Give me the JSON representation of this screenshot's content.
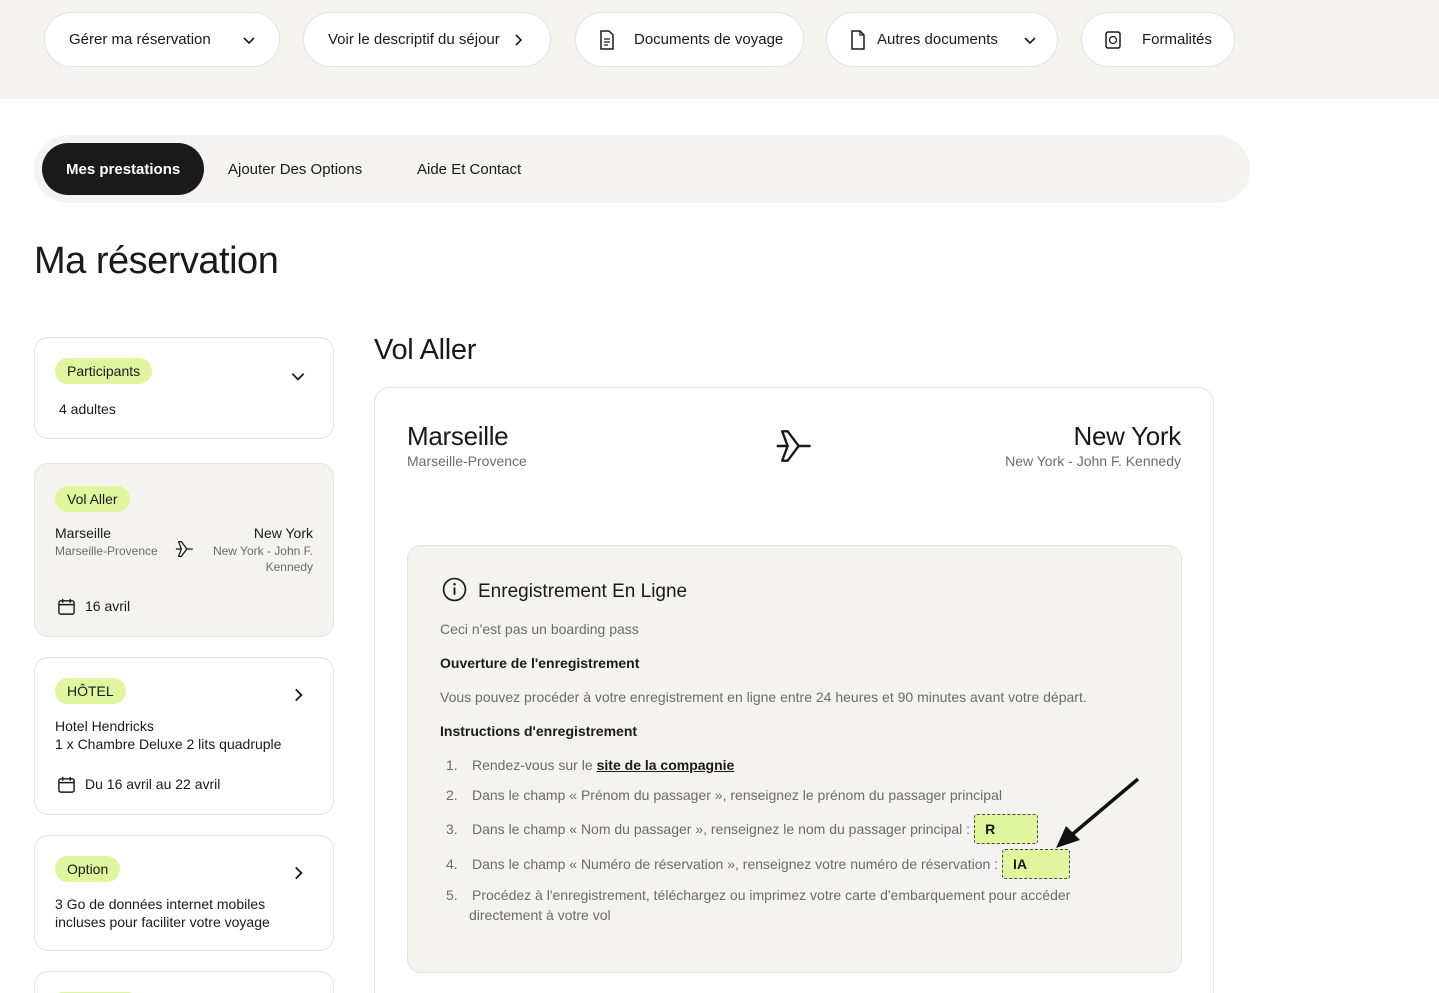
{
  "topbar": {
    "manage": "Gérer ma réservation",
    "descriptif": "Voir le descriptif du séjour",
    "documents": "Documents de voyage",
    "autres": "Autres documents",
    "formalites": "Formalités"
  },
  "tabs": [
    "Mes prestations",
    "Ajouter Des Options",
    "Aide Et Contact"
  ],
  "page_title": "Ma réservation",
  "sidebar": {
    "participants": {
      "badge": "Participants",
      "value": "4 adultes"
    },
    "vol": {
      "badge": "Vol Aller",
      "from_city": "Marseille",
      "from_airport": "Marseille-Provence",
      "to_city": "New York",
      "to_airport_1": "New York - John F.",
      "to_airport_2": "Kennedy",
      "date": "16 avril"
    },
    "hotel": {
      "badge": "HÔTEL",
      "name": "Hotel Hendricks",
      "room": "1 x Chambre Deluxe 2 lits quadruple",
      "dates": "Du 16 avril au 22 avril"
    },
    "option": {
      "badge": "Option",
      "text_1": "3 Go de données internet mobiles",
      "text_2": "incluses pour faciliter votre voyage"
    }
  },
  "main": {
    "section_title": "Vol Aller",
    "from_city": "Marseille",
    "from_airport": "Marseille-Provence",
    "to_city": "New York",
    "to_airport": "New York - John F. Kennedy",
    "checkin": {
      "title": "Enregistrement En Ligne",
      "not_boarding": "Ceci n'est pas un boarding pass",
      "opening_title": "Ouverture de l'enregistrement",
      "opening_text": "Vous pouvez procéder à votre enregistrement en ligne entre 24 heures et 90 minutes avant votre départ.",
      "instructions_title": "Instructions d'enregistrement",
      "steps": [
        {
          "num": "1.",
          "text": "Rendez-vous sur le ",
          "link": "site de la compagnie"
        },
        {
          "num": "2.",
          "text": "Dans le champ « Prénom du passager », renseignez le prénom du passager principal"
        },
        {
          "num": "3.",
          "text": "Dans le champ « Nom du passager », renseignez le nom du passager principal :",
          "value": "R"
        },
        {
          "num": "4.",
          "text": "Dans le champ « Numéro de réservation », renseignez votre numéro de réservation :",
          "value": "IA"
        },
        {
          "num": "5.",
          "text_1": "Procédez à l'enregistrement, téléchargez ou imprimez votre carte d'embarquement pour accéder",
          "text_2": "directement à votre vol"
        }
      ]
    }
  },
  "colors": {
    "accent": "#dff59e",
    "dark": "#1a1a1a",
    "beige": "#f5f3ef"
  }
}
